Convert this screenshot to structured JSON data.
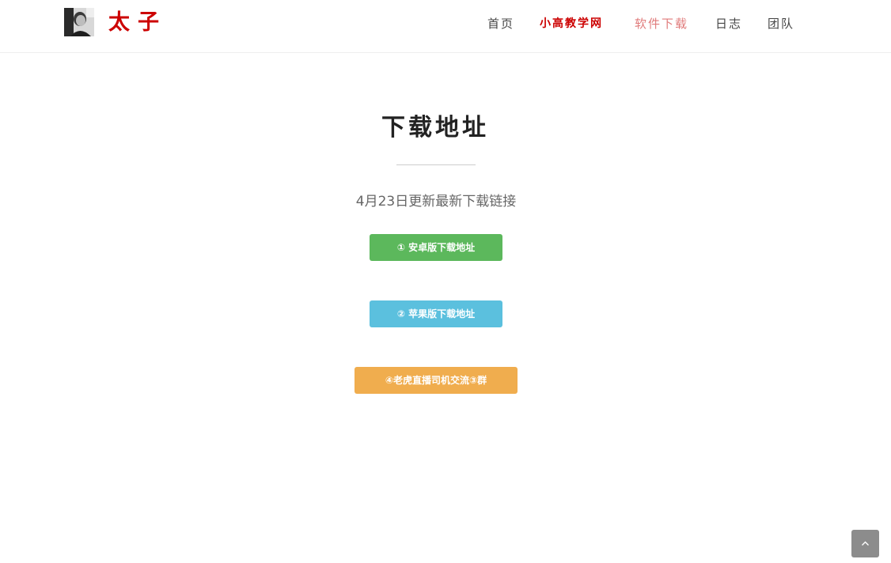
{
  "header": {
    "brand": "太子",
    "avatar_icon": "user-photo-icon",
    "nav": [
      {
        "label": "首页"
      },
      {
        "label": "小高教学网"
      },
      {
        "label": "软件下载"
      },
      {
        "label": "日志"
      },
      {
        "label": "团队"
      }
    ]
  },
  "main": {
    "title": "下载地址",
    "subtitle": "4月23日更新最新下载链接",
    "buttons": [
      {
        "label": "① 安卓版下载地址",
        "color": "#5cb85c"
      },
      {
        "label": "② 苹果版下载地址",
        "color": "#5bc0de"
      },
      {
        "label": "④老虎直播司机交流③群",
        "color": "#f0ad4e"
      }
    ]
  },
  "scroll_top": {
    "icon": "chevron-up-icon"
  }
}
